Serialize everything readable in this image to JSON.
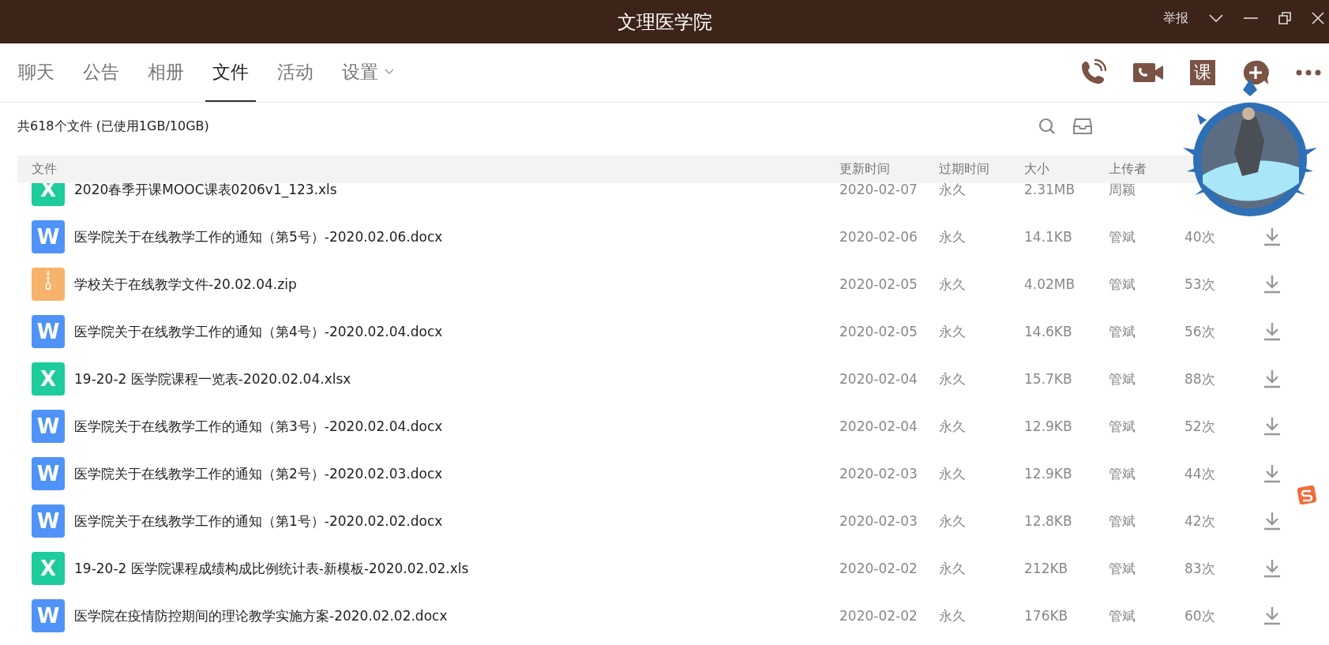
{
  "window": {
    "title": "文理医学院",
    "report": "举报"
  },
  "tabs": [
    {
      "label": "聊天",
      "selected": false,
      "dropdown": false
    },
    {
      "label": "公告",
      "selected": false,
      "dropdown": false
    },
    {
      "label": "相册",
      "selected": false,
      "dropdown": false
    },
    {
      "label": "文件",
      "selected": true,
      "dropdown": false
    },
    {
      "label": "活动",
      "selected": false,
      "dropdown": false
    },
    {
      "label": "设置",
      "selected": false,
      "dropdown": true
    }
  ],
  "toolbar": {
    "course_button": "课"
  },
  "summary": "共618个文件 (已使用1GB/10GB)",
  "table": {
    "columns": [
      "文件",
      "更新时间",
      "过期时间",
      "大小",
      "上传者"
    ],
    "rows": [
      {
        "kind": "excel",
        "icon_letter": "X",
        "name": "2020春季开课MOOC课表0206v1_123.xls",
        "updated": "2020-02-07",
        "expires": "永久",
        "size": "2.31MB",
        "uploader": "周颖"
      },
      {
        "kind": "word",
        "icon_letter": "W",
        "name": "医学院关于在线教学工作的通知（第5号）-2020.02.06.docx",
        "updated": "2020-02-06",
        "expires": "永久",
        "size": "14.1KB",
        "uploader": "管斌",
        "downloads": "40次"
      },
      {
        "kind": "zip",
        "name": "学校关于在线教学文件-20.02.04.zip",
        "updated": "2020-02-05",
        "expires": "永久",
        "size": "4.02MB",
        "uploader": "管斌",
        "downloads": "53次"
      },
      {
        "kind": "word",
        "icon_letter": "W",
        "name": "医学院关于在线教学工作的通知（第4号）-2020.02.04.docx",
        "updated": "2020-02-05",
        "expires": "永久",
        "size": "14.6KB",
        "uploader": "管斌",
        "downloads": "56次"
      },
      {
        "kind": "excel",
        "icon_letter": "X",
        "name": "19-20-2 医学院课程一览表-2020.02.04.xlsx",
        "updated": "2020-02-04",
        "expires": "永久",
        "size": "15.7KB",
        "uploader": "管斌",
        "downloads": "88次"
      },
      {
        "kind": "word",
        "icon_letter": "W",
        "name": "医学院关于在线教学工作的通知（第3号）-2020.02.04.docx",
        "updated": "2020-02-04",
        "expires": "永久",
        "size": "12.9KB",
        "uploader": "管斌",
        "downloads": "52次"
      },
      {
        "kind": "word",
        "icon_letter": "W",
        "name": "医学院关于在线教学工作的通知（第2号）-2020.02.03.docx",
        "updated": "2020-02-03",
        "expires": "永久",
        "size": "12.9KB",
        "uploader": "管斌",
        "downloads": "44次"
      },
      {
        "kind": "word",
        "icon_letter": "W",
        "name": "医学院关于在线教学工作的通知（第1号）-2020.02.02.docx",
        "updated": "2020-02-03",
        "expires": "永久",
        "size": "12.8KB",
        "uploader": "管斌",
        "downloads": "42次"
      },
      {
        "kind": "excel",
        "icon_letter": "X",
        "name": "19-20-2 医学院课程成绩构成比例统计表-新模板-2020.02.02.xls",
        "updated": "2020-02-02",
        "expires": "永久",
        "size": "212KB",
        "uploader": "管斌",
        "downloads": "83次"
      },
      {
        "kind": "word",
        "icon_letter": "W",
        "name": "医学院在疫情防控期间的理论教学实施方案-2020.02.02.docx",
        "updated": "2020-02-02",
        "expires": "永久",
        "size": "176KB",
        "uploader": "管斌",
        "downloads": "60次"
      }
    ]
  }
}
